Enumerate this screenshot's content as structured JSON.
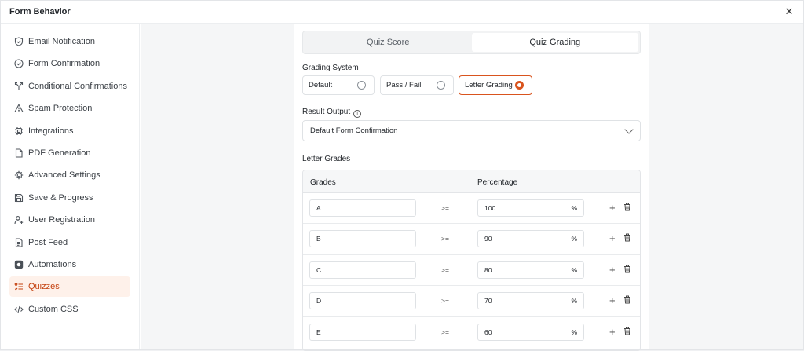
{
  "window": {
    "title": "Form Behavior"
  },
  "sidebar": {
    "items": [
      {
        "label": "Email Notification",
        "icon": "shield-check-icon"
      },
      {
        "label": "Form Confirmation",
        "icon": "check-circle-icon"
      },
      {
        "label": "Conditional Confirmations",
        "icon": "branch-icon"
      },
      {
        "label": "Spam Protection",
        "icon": "warning-icon"
      },
      {
        "label": "Integrations",
        "icon": "chip-icon"
      },
      {
        "label": "PDF Generation",
        "icon": "document-icon"
      },
      {
        "label": "Advanced Settings",
        "icon": "gear-icon"
      },
      {
        "label": "Save & Progress",
        "icon": "save-icon"
      },
      {
        "label": "User Registration",
        "icon": "user-plus-icon"
      },
      {
        "label": "Post Feed",
        "icon": "post-icon"
      },
      {
        "label": "Automations",
        "icon": "automation-icon"
      },
      {
        "label": "Quizzes",
        "icon": "quiz-list-icon",
        "active": true
      },
      {
        "label": "Custom CSS",
        "icon": "code-icon"
      }
    ]
  },
  "tabs": [
    {
      "label": "Quiz Score",
      "active": false
    },
    {
      "label": "Quiz Grading",
      "active": true
    }
  ],
  "grading": {
    "label": "Grading System",
    "options": [
      {
        "label": "Default",
        "selected": false
      },
      {
        "label": "Pass / Fail",
        "selected": false
      },
      {
        "label": "Letter Grading",
        "selected": true
      }
    ]
  },
  "result_output": {
    "label": "Result Output",
    "value": "Default Form Confirmation"
  },
  "letter_grades": {
    "label": "Letter Grades",
    "col_grades": "Grades",
    "col_percentage": "Percentage",
    "operator": ">=",
    "unit": "%",
    "add_symbol": "+",
    "rows": [
      {
        "grade": "A",
        "percentage": "100"
      },
      {
        "grade": "B",
        "percentage": "90"
      },
      {
        "grade": "C",
        "percentage": "80"
      },
      {
        "grade": "D",
        "percentage": "70"
      },
      {
        "grade": "E",
        "percentage": "60"
      }
    ]
  },
  "colors": {
    "accent": "#d9541e",
    "active_bg": "#fef1ea"
  }
}
